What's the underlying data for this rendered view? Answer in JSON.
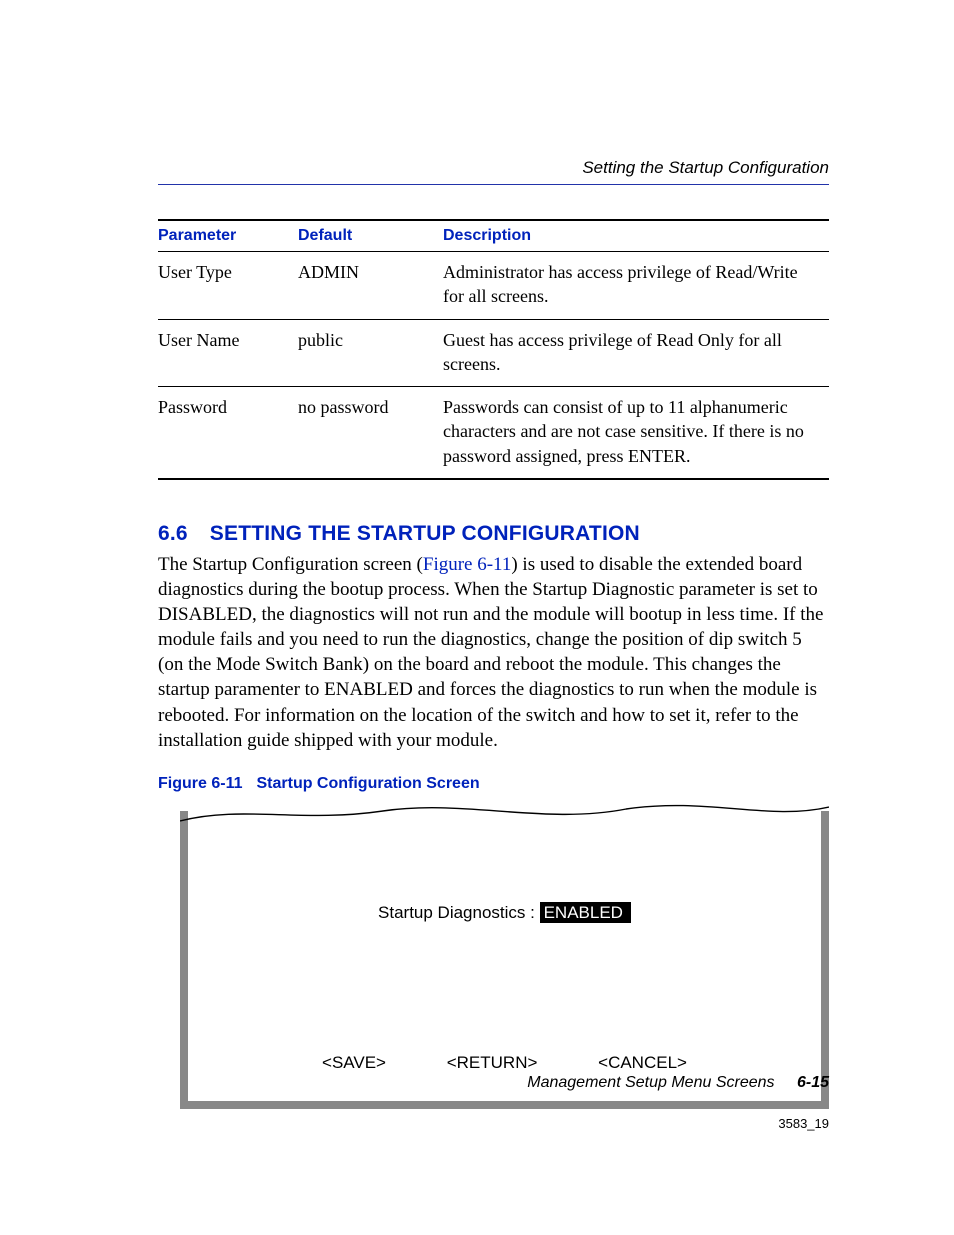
{
  "header": {
    "running_head": "Setting the Startup Configuration"
  },
  "table": {
    "columns": {
      "param": "Parameter",
      "default": "Default",
      "desc": "Description"
    },
    "rows": [
      {
        "param": "User Type",
        "default": "ADMIN",
        "desc": "Administrator has access privilege of Read/Write for all screens."
      },
      {
        "param": "User Name",
        "default": "public",
        "desc": "Guest has access privilege of Read Only for all screens."
      },
      {
        "param": "Password",
        "default": "no password",
        "desc": "Passwords can consist of up to 11 alphanumeric characters and are not case sensitive. If there is no password assigned, press ENTER."
      }
    ]
  },
  "section": {
    "number": "6.6",
    "title": "SETTING THE STARTUP CONFIGURATION",
    "para_before_ref": "The Startup Configuration screen (",
    "para_ref": "Figure 6-11",
    "para_after_ref": ") is used to disable the extended board diagnostics during the bootup process. When the Startup Diagnostic parameter is set to DISABLED, the diagnostics will not run and the module will bootup in less time. If the module fails and you need to run the diagnostics, change the position of dip switch 5 (on the Mode Switch Bank) on the board and reboot the module. This changes the startup paramenter to ENABLED and forces the diagnostics to run when the module is rebooted. For information on the location of the switch and how to set it, refer to the installation guide shipped with your module."
  },
  "figure": {
    "label": "Figure 6-11",
    "title": "Startup Configuration Screen",
    "screen": {
      "diag_label": "Startup Diagnostics : ",
      "diag_value": "ENABLED",
      "actions": {
        "save": "<SAVE>",
        "ret": "<RETURN>",
        "cancel": "<CANCEL>"
      }
    },
    "id": "3583_19"
  },
  "footer": {
    "text": "Management Setup Menu Screens",
    "page": "6-15"
  }
}
